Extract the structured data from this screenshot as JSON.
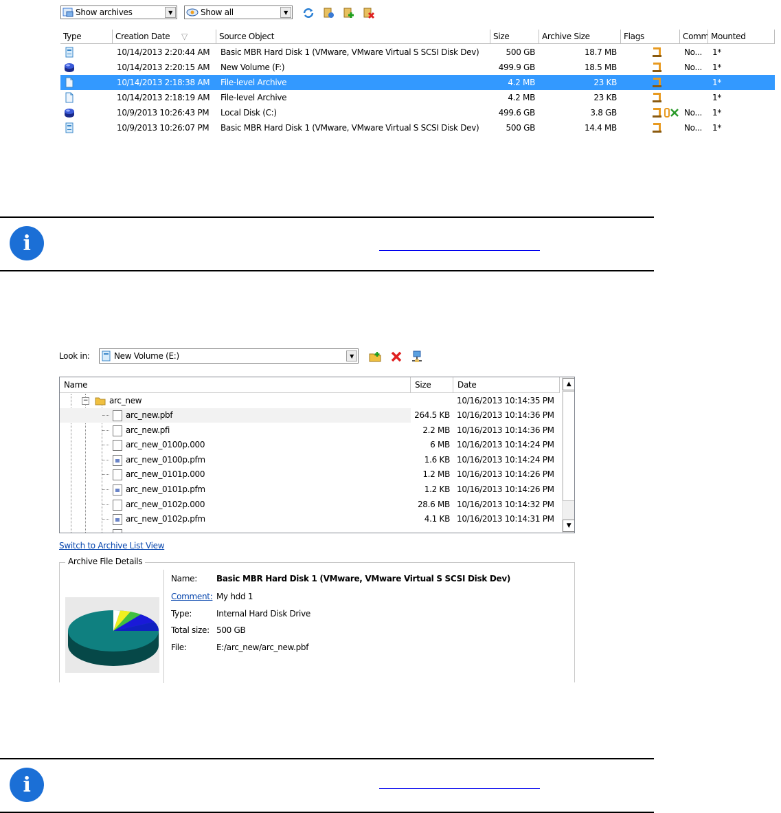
{
  "toolbar": {
    "archives_filter": "Show archives",
    "show_filter": "Show all",
    "icons": [
      "refresh-icon",
      "settings-icon",
      "add-icon",
      "delete-icon"
    ]
  },
  "archive_table": {
    "columns": [
      "Type",
      "Creation Date",
      "Source Object",
      "Size",
      "Archive Size",
      "Flags",
      "Comm",
      "Mounted"
    ],
    "rows": [
      {
        "type_icon": "hard-disk-icon",
        "date": "10/14/2013 2:20:44 AM",
        "source": "Basic MBR Hard Disk 1 (VMware, VMware Virtual S SCSI Disk Dev)",
        "size": "500 GB",
        "archive_size": "18.7 MB",
        "comment": "No...",
        "mounted": "1*",
        "selected": false
      },
      {
        "type_icon": "volume-icon",
        "date": "10/14/2013 2:20:15 AM",
        "source": "New Volume (F:)",
        "size": "499.9 GB",
        "archive_size": "18.5 MB",
        "comment": "No...",
        "mounted": "1*",
        "selected": false
      },
      {
        "type_icon": "file-archive-icon",
        "date": "10/14/2013 2:18:38 AM",
        "source": "File-level Archive",
        "size": "4.2 MB",
        "archive_size": "23 KB",
        "comment": "",
        "mounted": "1*",
        "selected": true
      },
      {
        "type_icon": "file-archive-icon",
        "date": "10/14/2013 2:18:19 AM",
        "source": "File-level Archive",
        "size": "4.2 MB",
        "archive_size": "23 KB",
        "comment": "",
        "mounted": "1*",
        "selected": false
      },
      {
        "type_icon": "volume-icon",
        "date": "10/9/2013 10:26:43 PM",
        "source": "Local Disk (C:)",
        "size": "499.6 GB",
        "archive_size": "3.8 GB",
        "comment": "No...",
        "mounted": "1*",
        "selected": false
      },
      {
        "type_icon": "hard-disk-icon",
        "date": "10/9/2013 10:26:07 PM",
        "source": "Basic MBR Hard Disk 1 (VMware, VMware Virtual S SCSI Disk Dev)",
        "size": "500 GB",
        "archive_size": "14.4 MB",
        "comment": "No...",
        "mounted": "1*",
        "selected": false
      }
    ]
  },
  "file_browser": {
    "look_in_label": "Look in:",
    "look_in_value": "New Volume (E:)",
    "columns": [
      "Name",
      "Size",
      "Date"
    ],
    "folder": {
      "name": "arc_new",
      "date": "10/16/2013 10:14:35 PM"
    },
    "files": [
      {
        "name": "arc_new.pbf",
        "size": "264.5 KB",
        "date": "10/16/2013 10:14:36 PM",
        "kind": "file"
      },
      {
        "name": "arc_new.pfi",
        "size": "2.2 MB",
        "date": "10/16/2013 10:14:36 PM",
        "kind": "file"
      },
      {
        "name": "arc_new_0100p.000",
        "size": "6 MB",
        "date": "10/16/2013 10:14:24 PM",
        "kind": "file"
      },
      {
        "name": "arc_new_0100p.pfm",
        "size": "1.6 KB",
        "date": "10/16/2013 10:14:24 PM",
        "kind": "pfm"
      },
      {
        "name": "arc_new_0101p.000",
        "size": "1.2 MB",
        "date": "10/16/2013 10:14:26 PM",
        "kind": "file"
      },
      {
        "name": "arc_new_0101p.pfm",
        "size": "1.2 KB",
        "date": "10/16/2013 10:14:26 PM",
        "kind": "pfm"
      },
      {
        "name": "arc_new_0102p.000",
        "size": "28.6 MB",
        "date": "10/16/2013 10:14:32 PM",
        "kind": "file"
      },
      {
        "name": "arc_new_0102p.pfm",
        "size": "4.1 KB",
        "date": "10/16/2013 10:14:31 PM",
        "kind": "pfm"
      }
    ],
    "switch_link": "Switch to Archive List View"
  },
  "details": {
    "group_title": "Archive File Details",
    "name_label": "Name:",
    "name_value": "Basic MBR Hard Disk 1 (VMware, VMware Virtual S SCSI Disk Dev)",
    "comment_label": "Comment:",
    "comment_value": "My hdd 1",
    "type_label": "Type:",
    "type_value": "Internal Hard Disk Drive",
    "total_label": "Total size:",
    "total_value": "500 GB",
    "file_label": "File:",
    "file_value": "E:/arc_new/arc_new.pbf"
  },
  "colors": {
    "selection": "#3399ff",
    "info": "#1b6fd6",
    "pie_main": "#0f8080",
    "link": "#0645ad"
  }
}
